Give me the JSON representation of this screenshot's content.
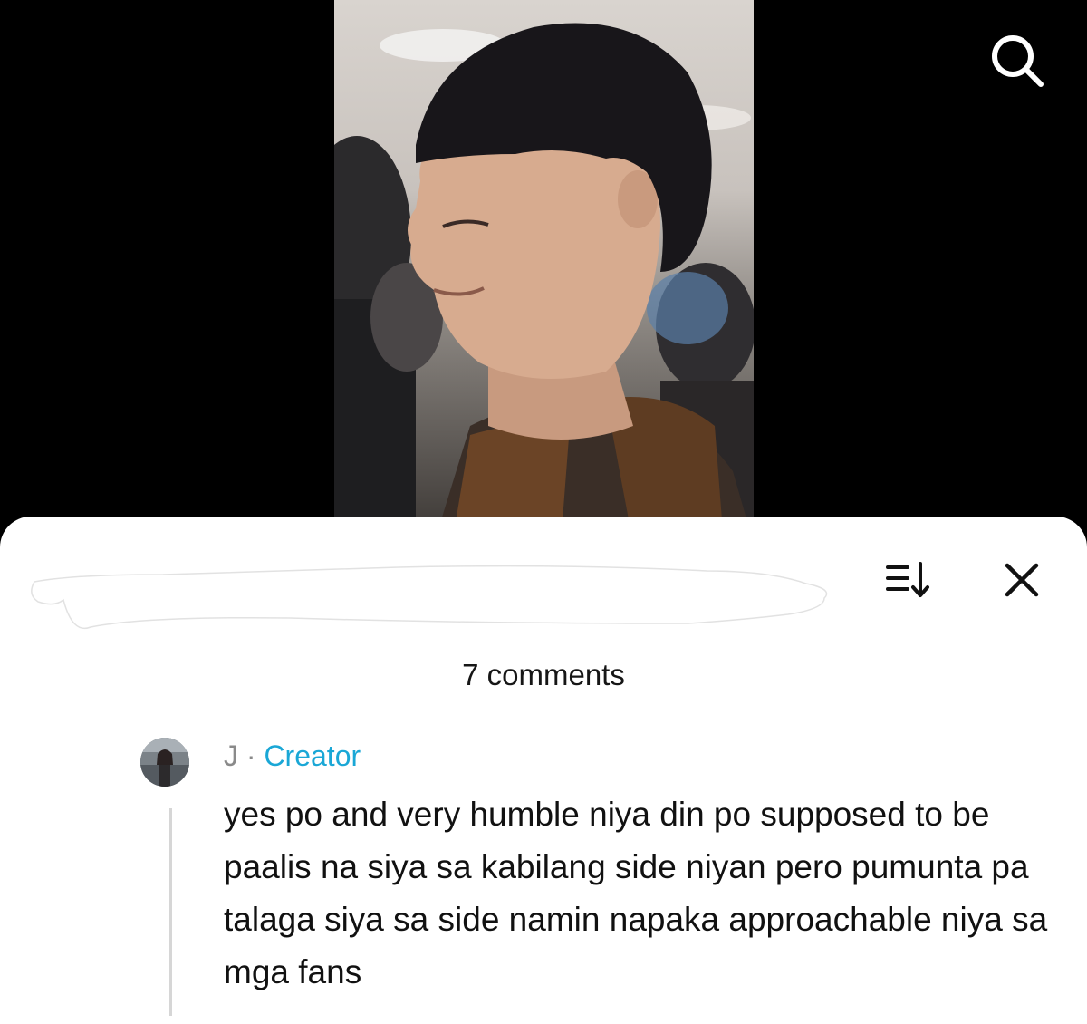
{
  "video": {
    "search_icon": "search-icon"
  },
  "comments_sheet": {
    "title_redacted": true,
    "sort_icon": "sort-icon",
    "close_icon": "close-icon",
    "count_label": "7 comments",
    "comments": [
      {
        "author": "J",
        "separator": "·",
        "badge": "Creator",
        "text": "yes po and very humble niya din po supposed to be paalis na siya sa kabilang side niyan pero pumunta pa talaga siya sa side namin napaka approachable niya sa mga fans"
      }
    ]
  },
  "colors": {
    "background": "#000000",
    "sheet": "#ffffff",
    "creator_badge": "#1aa7d6",
    "author": "#8a8a8a"
  }
}
